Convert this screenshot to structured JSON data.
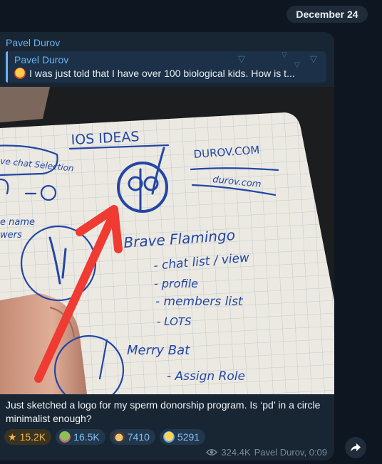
{
  "chat": {
    "date_separator": "December 24"
  },
  "message": {
    "sender": "Pavel Durov",
    "reply": {
      "author": "Pavel Durov",
      "text": "I was just told that I have over 100 biological kids. How is t..."
    },
    "photo": {
      "alt": "Handwritten notebook page sketch",
      "notes": {
        "title": "IOS IDEAS",
        "domain_upper": "DUROV.COM",
        "domain_lower": "durov.com",
        "chat_selection": "ve chat Selection",
        "rename": "e name",
        "viewers": "wers",
        "brave": "Brave Flamingo",
        "item1": "- chat list / view",
        "item2": "- profile",
        "item3": "- members list",
        "item4": "- LOTS",
        "merry": "Merry Bat",
        "assign": "- Assign Role",
        "logo_letters": "pd"
      }
    },
    "caption": "Just sketched a logo for my sperm donorship program. Is ‘pd’ in a circle minimalist enough?",
    "reactions": [
      {
        "emoji": "star-icon",
        "count": "15.2K",
        "selected": true
      },
      {
        "emoji": "frog-icon",
        "count": "16.5K",
        "selected": false
      },
      {
        "emoji": "nerd-icon",
        "count": "7410",
        "selected": false
      },
      {
        "emoji": "crying-icon",
        "count": "5291",
        "selected": false
      }
    ],
    "views": "324.4K",
    "signature": "Pavel Durov, 0:09"
  },
  "colors": {
    "background": "#0e1621",
    "bubble": "#182533",
    "accent": "#6ab3f3",
    "ink": "#2346a6",
    "arrow": "#ef3b32"
  }
}
